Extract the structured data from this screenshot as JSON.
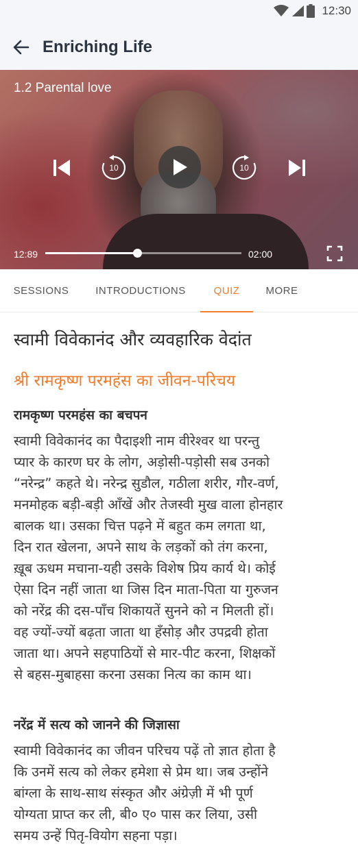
{
  "status_bar": {
    "time": "12:30",
    "icons": [
      "wifi-icon",
      "signal-icon",
      "battery-icon"
    ]
  },
  "app_bar": {
    "back_icon": "arrow-left-icon",
    "title": "Enriching Life"
  },
  "player": {
    "session_title": "1.2 Parental love",
    "current_time": "12:89",
    "duration": "02:00",
    "progress": 0.47,
    "rewind_seconds": "10",
    "forward_seconds": "10",
    "controls": [
      "skip-previous-icon",
      "rewind-10-icon",
      "play-icon",
      "forward-10-icon",
      "skip-next-icon",
      "fullscreen-icon"
    ]
  },
  "tabs": [
    {
      "label": "SESSIONS",
      "active": false
    },
    {
      "label": "INTRODUCTIONS",
      "active": false
    },
    {
      "label": "QUIZ",
      "active": true
    },
    {
      "label": "MORE",
      "active": false
    }
  ],
  "colors": {
    "accent": "#f07c2c",
    "title": "#2b3440",
    "appbar_bg": "#f4f6f9"
  },
  "article": {
    "title": "स्वामी विवेकानंद और व्यवहारिक वेदांत",
    "subtitle": "श्री रामकृष्ण परमहंस का जीवन-परिचय",
    "sections": [
      {
        "heading": "रामकृष्ण परमहंस का बचपन",
        "lines": [
          "स्वामी विवेकानंद का पैदाइशी नाम वीरेश्वर था परन्तु",
          "प्यार के कारण घर के लोग, अड़ोसी-पड़ोसी सब उनको",
          "“नरेन्द्र” कहते थे। नरेन्द्र सुडौल, गठीला शरीर, गौर-वर्ण,",
          "मनमोहक बड़ी-बड़ी आँखें और तेजस्वी मुख वाला होनहार",
          "बालक था। उसका चित्त पढ़ने में बहुत कम लगता था,",
          "दिन रात खेलना, अपने साथ के लड़कों को तंग करना,",
          "ख़ूब ऊधम मचाना-यही उसके विशेष प्रिय कार्य थे। कोई",
          "ऐसा दिन नहीं जाता था जिस दिन माता-पिता या गुरुजन",
          "को नरेंद्र की दस-पाँच शिकायतें सुनने को न मिलती हों।",
          "वह ज्यों-ज्यों बढ़ता जाता था हँसोड़ और उपद्रवी होता",
          "जाता था। अपने सहपाठियों से मार-पीट करना, शिक्षकों",
          "से बहस-मुबाहसा करना उसका नित्य का काम था।"
        ]
      },
      {
        "heading": "नरेंद्र में सत्य को जानने की जिज्ञासा",
        "lines": [
          "स्वामी विवेकानंद का जीवन परिचय पढ़ें तो ज्ञात होता है",
          "कि उनमें सत्य को लेकर हमेशा से प्रेम था। जब उन्होंने",
          "बांग्ला के साथ-साथ संस्कृत और अंग्रेज़ी में भी पूर्ण",
          "योग्यता प्राप्त कर ली, बी० ए० पास कर लिया, उसी",
          "समय उन्हें पितृ-वियोग सहना पड़ा।"
        ]
      }
    ]
  }
}
